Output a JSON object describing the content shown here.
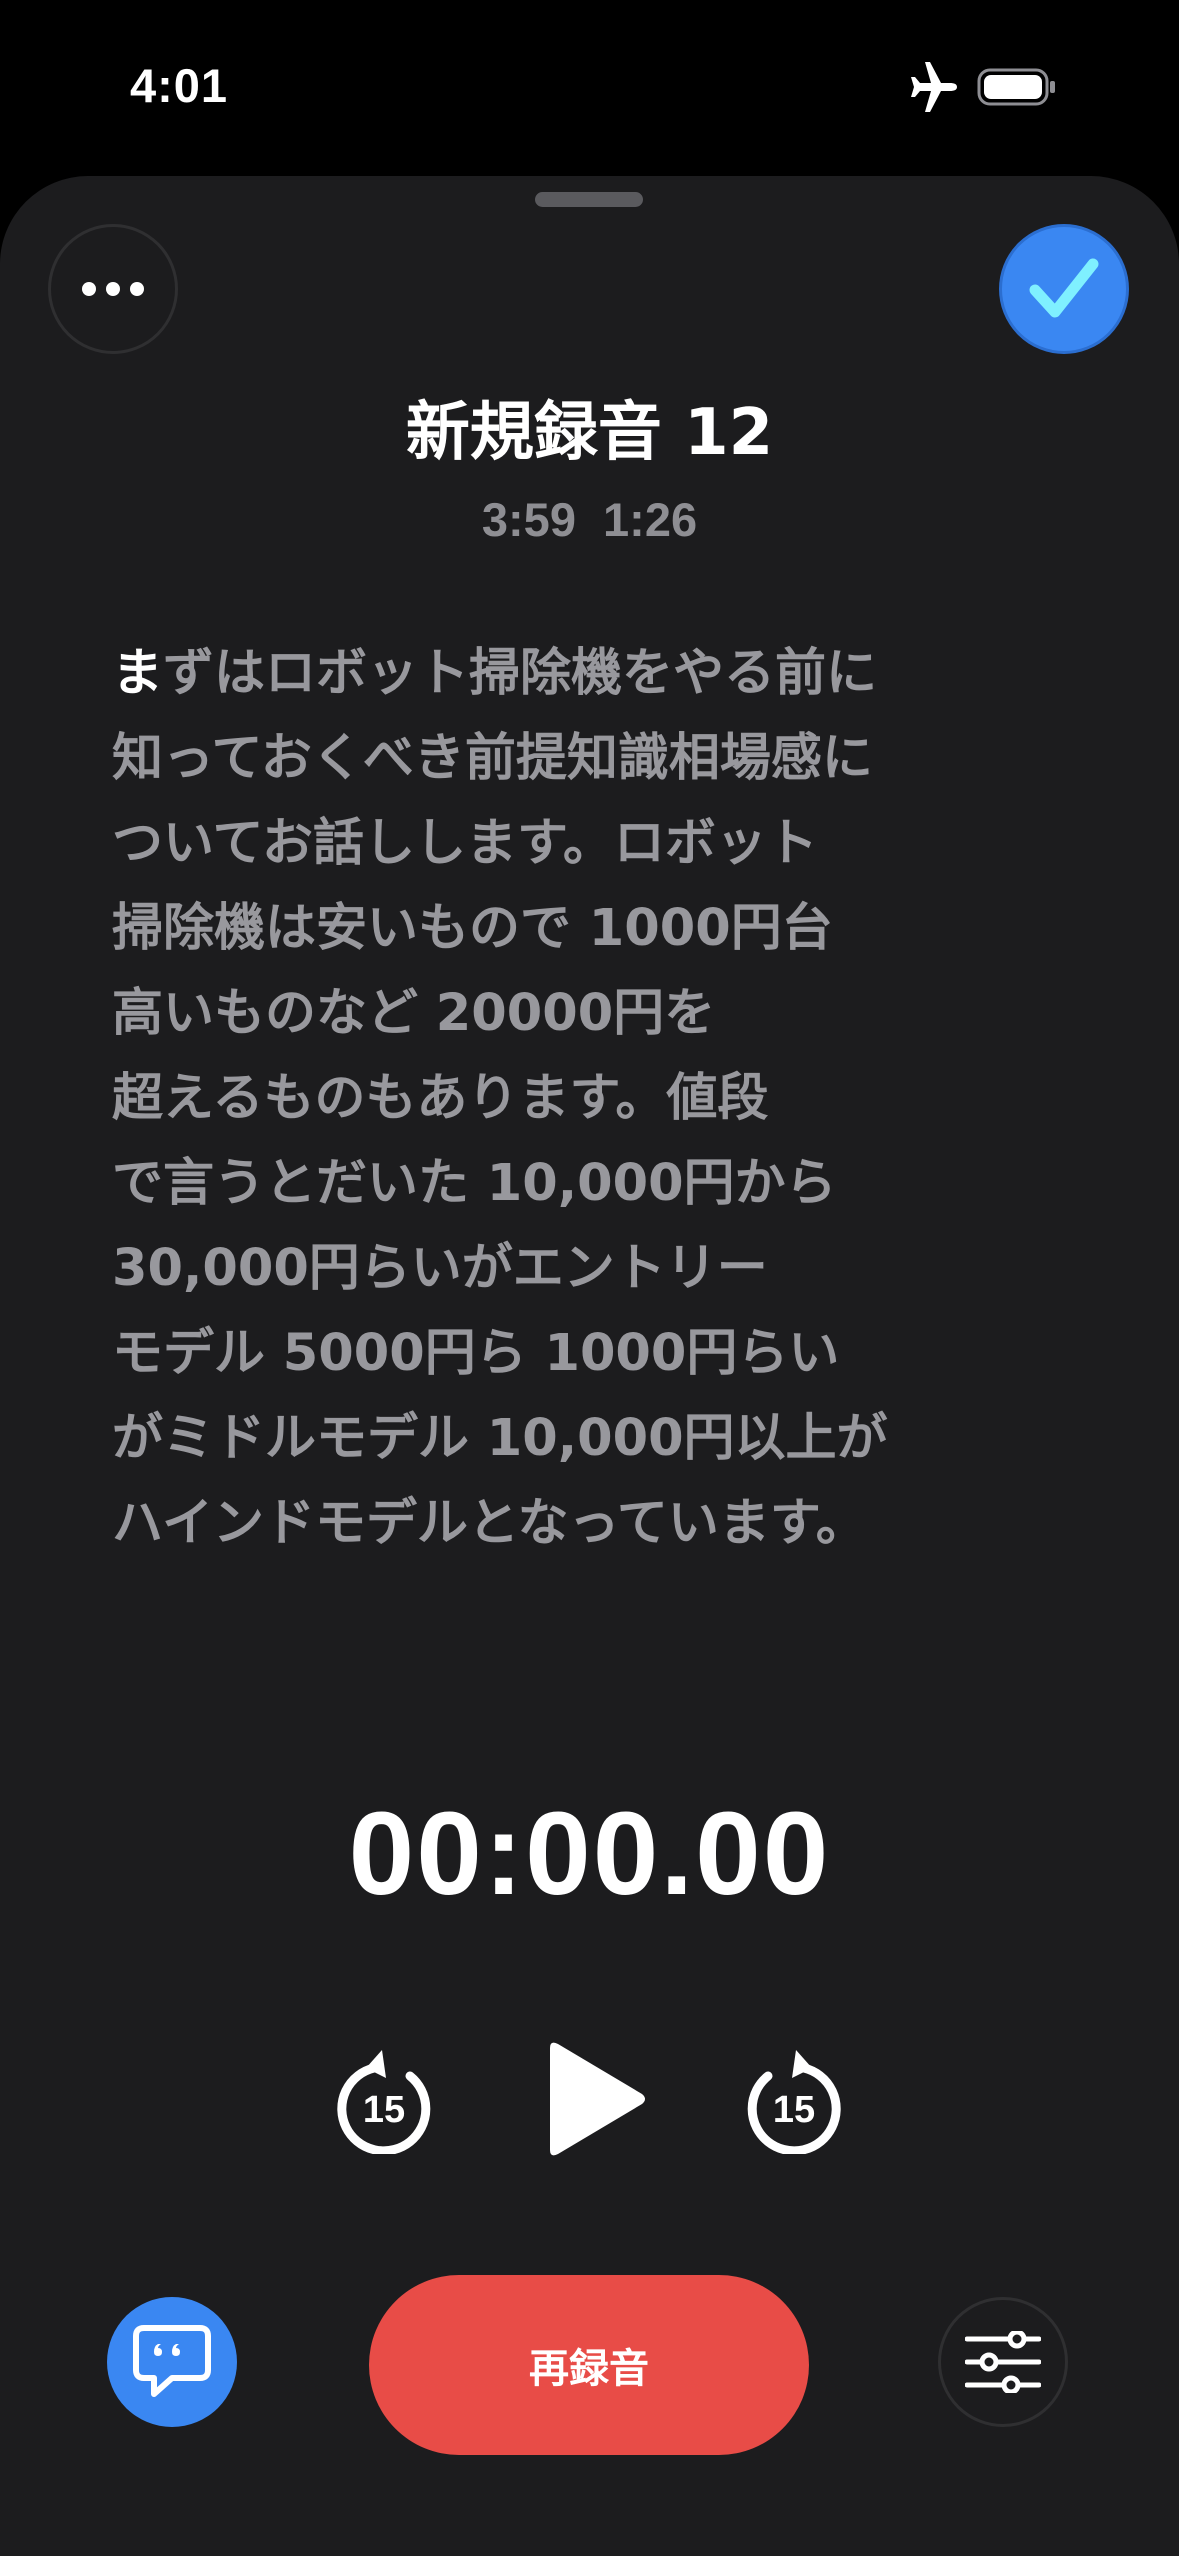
{
  "status_bar": {
    "time": "4:01",
    "icons": [
      "airplane-icon",
      "battery-icon"
    ]
  },
  "recording": {
    "title": "新規録音 12",
    "time_of_day": "3:59",
    "duration": "1:26"
  },
  "transcript": {
    "highlighted": "ま",
    "text": "ずはロボット掃除機をやる前に\n知っておくべき前提知識相場感に\nついてお話しします。ロボット\n掃除機は安いもので 1000円台\n高いものなど 20000円を\n超えるものもあります。値段\nで言うとだいた 10,000円から\n30,000円らいがエントリー\nモデル 5000円ら 1000円らい\nがミドルモデル 10,000円以上が\nハインドモデルとなっています。"
  },
  "player": {
    "elapsed": "00:00.00",
    "skip_back_label": "15",
    "skip_forward_label": "15"
  },
  "actions": {
    "rerecord_label": "再録音"
  },
  "colors": {
    "background": "#000000",
    "sheet": "#1c1c1e",
    "accent_blue": "#3a87f2",
    "record_red": "#e84c47",
    "secondary_text": "#98989d",
    "checkmark": "#7ff0ff"
  }
}
